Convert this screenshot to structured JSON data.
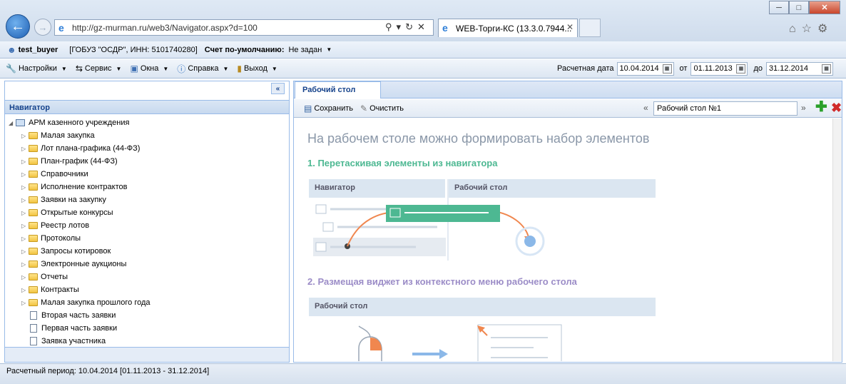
{
  "browser": {
    "url": "http://gz-murman.ru/web3/Navigator.aspx?d=100",
    "tab_title": "WEB-Торги-КС (13.3.0.7944...",
    "window_controls": [
      "minimize-icon",
      "maximize-icon",
      "close-icon"
    ],
    "icons": [
      "back-arrow-icon",
      "forward-arrow-icon",
      "search-icon",
      "refresh-icon",
      "stop-icon",
      "home-icon",
      "star-icon",
      "gear-icon"
    ]
  },
  "userbar": {
    "username": "test_buyer",
    "org": "[ГОБУЗ \"ОСДР\", ИНН: 5101740280]",
    "default_account_label": "Счет по-умолчанию:",
    "default_account_value": "Не задан"
  },
  "menu": {
    "items": [
      {
        "label": "Настройки",
        "icon": "settings-icon"
      },
      {
        "label": "Сервис",
        "icon": "service-icon"
      },
      {
        "label": "Окна",
        "icon": "windows-icon"
      },
      {
        "label": "Справка",
        "icon": "help-icon"
      },
      {
        "label": "Выход",
        "icon": "exit-icon"
      }
    ],
    "calc_date_label": "Расчетная дата",
    "calc_date_value": "10.04.2014",
    "from_label": "от",
    "from_value": "01.11.2013",
    "to_label": "до",
    "to_value": "31.12.2014"
  },
  "navigator": {
    "title": "Навигатор",
    "collapse_glyph": "«",
    "root": "АРМ казенного учреждения",
    "folders": [
      "Малая закупка",
      "Лот плана-графика (44-ФЗ)",
      "План-график (44-ФЗ)",
      "Справочники",
      "Исполнение контрактов",
      "Заявки на закупку",
      "Открытые конкурсы",
      "Реестр лотов",
      "Протоколы",
      "Запросы котировок",
      "Электронные аукционы",
      "Отчеты",
      "Контракты",
      "Малая закупка прошлого года"
    ],
    "documents": [
      "Вторая часть заявки",
      "Первая часть заявки",
      "Заявка участника"
    ]
  },
  "workspace": {
    "tab_label": "Рабочий стол",
    "save_label": "Сохранить",
    "clear_label": "Очистить",
    "desk_name": "Рабочий стол №1",
    "prev_glyph": "«",
    "next_glyph": "»",
    "add_glyph": "✚",
    "delete_glyph": "✖",
    "heading": "На рабочем столе можно формировать набор элементов",
    "step1": "1. Перетаскивая элементы из навигатора",
    "step1_panel_left": "Навигатор",
    "step1_panel_right": "Рабочий стол",
    "step2": "2. Размещая виджет из контекстного меню рабочего стола",
    "step2_panel": "Рабочий стол"
  },
  "status": {
    "text": "Расчетный период: 10.04.2014 [01.11.2013 - 31.12.2014]"
  },
  "colors": {
    "step1": "#4db892",
    "step2": "#9b8cc7",
    "accent_orange": "#f0874f",
    "panel_blue": "#dbe6f1"
  }
}
